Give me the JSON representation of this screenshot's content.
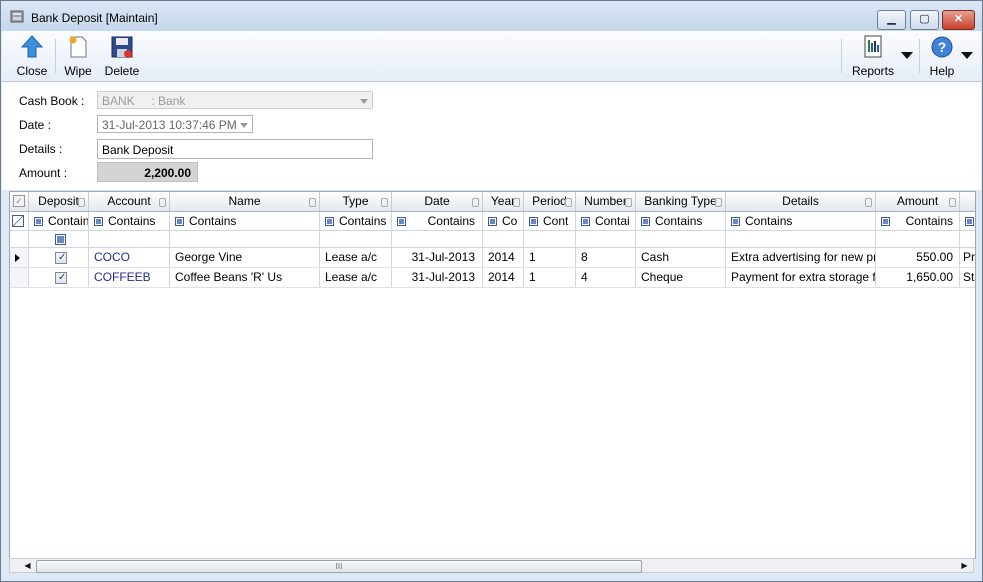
{
  "window": {
    "title": "Bank Deposit [Maintain]",
    "controls": {
      "minimize": "▁",
      "maximize": "▢",
      "close": "✕"
    }
  },
  "toolbar": {
    "close_label": "Close",
    "wipe_label": "Wipe",
    "delete_label": "Delete",
    "reports_label": "Reports",
    "help_label": "Help"
  },
  "form": {
    "cash_book_label": "Cash Book :",
    "cash_book_value": "BANK     : Bank",
    "date_label": "Date :",
    "date_value": "31-Jul-2013 10:37:46 PM",
    "details_label": "Details :",
    "details_value": "Bank Deposit",
    "amount_label": "Amount :",
    "amount_value": "2,200.00"
  },
  "grid": {
    "headers": [
      "Deposit",
      "Account",
      "Name",
      "Type",
      "Date",
      "Year",
      "Period",
      "Number",
      "Banking Type",
      "Details",
      "Amount"
    ],
    "filters": [
      "Contain",
      "Contains",
      "Contains",
      "Contains",
      "Contains",
      "Co",
      "Cont",
      "Contai",
      "Contains",
      "Contains",
      "Contains",
      ""
    ],
    "rows": [
      {
        "deposit": true,
        "account": "COCO",
        "name": "George Vine",
        "type": "Lease a/c",
        "date": "31-Jul-2013",
        "year": "2014",
        "period": "1",
        "number": "8",
        "banking_type": "Cash",
        "details": "Extra advertising for new pr",
        "amount": "550.00",
        "extra": "Pr"
      },
      {
        "deposit": true,
        "account": "COFFEEB",
        "name": "Coffee Beans 'R' Us",
        "type": "Lease a/c",
        "date": "31-Jul-2013",
        "year": "2014",
        "period": "1",
        "number": "4",
        "banking_type": "Cheque",
        "details": "Payment for extra storage f",
        "amount": "1,650.00",
        "extra": "St"
      }
    ]
  },
  "scrollbar": {
    "grip": "III",
    "left": "◀",
    "right": "▶"
  },
  "icons": {
    "close": "arrow-up-icon",
    "wipe": "new-document-icon",
    "delete": "floppy-delete-icon",
    "reports": "report-icon",
    "help": "help-icon"
  },
  "colors": {
    "accent": "#1f2f8f",
    "titlebar": "#c6d7ec",
    "close_button": "#c6402a"
  }
}
